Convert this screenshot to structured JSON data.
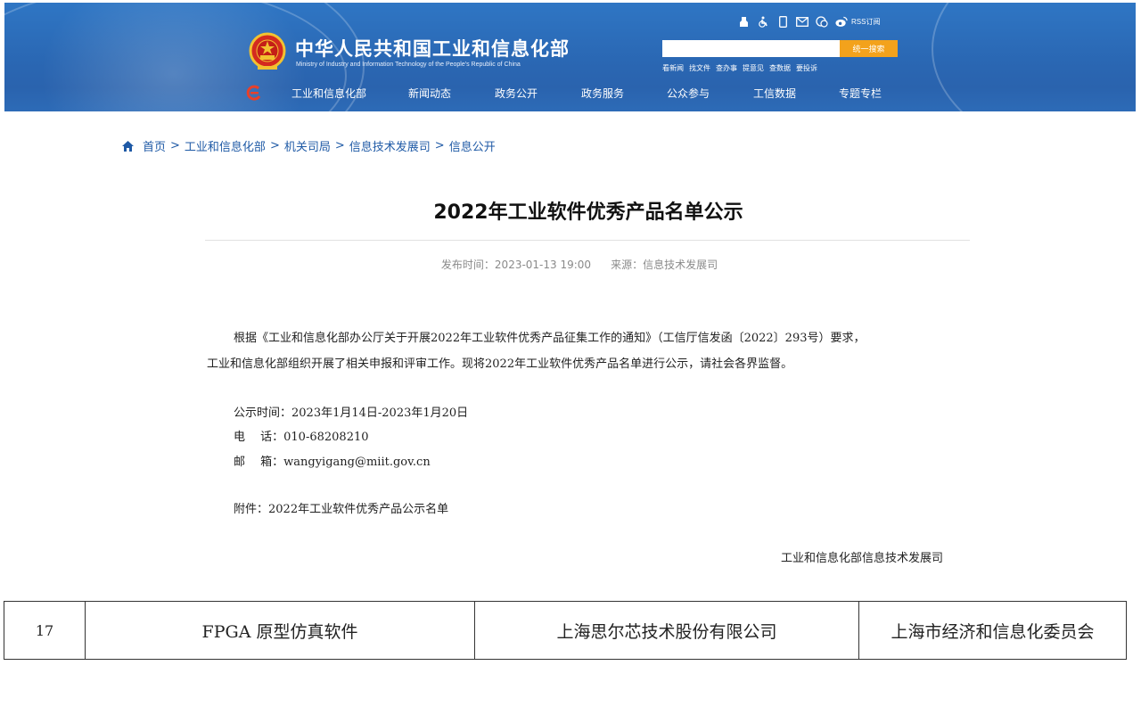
{
  "header": {
    "site_title": "中华人民共和国工业和信息化部",
    "site_subtitle": "Ministry of Industry and Information Technology of the People's Republic of China",
    "utility_icons": [
      "accessibility-icon",
      "wheelchair-icon",
      "mobile-icon",
      "mail-icon",
      "weibo-icon",
      "wechat-icon"
    ],
    "rss_label": "RSS订阅",
    "search": {
      "placeholder": "",
      "button_label": "统一搜索"
    },
    "quick_links": [
      "看新闻",
      "找文件",
      "查办事",
      "提意见",
      "查数据",
      "要投诉"
    ],
    "nav_items": [
      "工业和信息化部",
      "新闻动态",
      "政务公开",
      "政务服务",
      "公众参与",
      "工信数据",
      "专题专栏"
    ],
    "colors": {
      "banner_blue": "#2a67b3",
      "search_button": "#f3a21c",
      "link_blue": "#1f5aa6"
    }
  },
  "breadcrumb": {
    "items": [
      "首页",
      "工业和信息化部",
      "机关司局",
      "信息技术发展司",
      "信息公开"
    ],
    "separator": ">"
  },
  "article": {
    "title": "2022年工业软件优秀产品名单公示",
    "publish_time_label": "发布时间：2023-01-13 19:00",
    "source_label": "来源：信息技术发展司",
    "paragraph_line1": "根据《工业和信息化部办公厅关于开展2022年工业软件优秀产品征集工作的通知》（工信厅信发函〔2022〕293号）要求，",
    "paragraph_line2": "工业和信息化部组织开展了相关申报和评审工作。现将2022年工业软件优秀产品名单进行公示，请社会各界监督。",
    "notice_period": "公示时间：2023年1月14日-2023年1月20日",
    "phone": "电　 话：010-68208210",
    "email": "邮　 箱：wangyigang@miit.gov.cn",
    "attachment": "附件：2022年工业软件优秀产品公示名单",
    "signature": "工业和信息化部信息技术发展司"
  },
  "table": {
    "rows": [
      {
        "no": "17",
        "product": "FPGA 原型仿真软件",
        "company": "上海思尔芯技术股份有限公司",
        "recommender": "上海市经济和信息化委员会"
      }
    ]
  }
}
